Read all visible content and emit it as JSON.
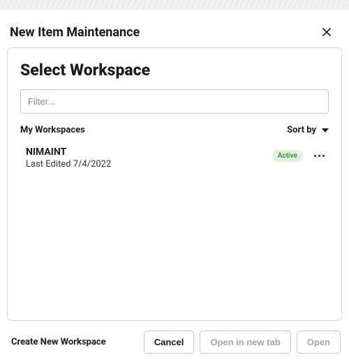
{
  "modal": {
    "title": "New Item Maintenance"
  },
  "card": {
    "title": "Select Workspace",
    "filter_placeholder": "Filter..."
  },
  "list_header": {
    "my_label": "My Workspaces",
    "sort_label": "Sort by"
  },
  "workspaces": [
    {
      "name": "NIMAINT",
      "last_edited": "Last Edited 7/4/2022",
      "status": "Active"
    }
  ],
  "footer": {
    "create_label": "Create New Workspace",
    "cancel": "Cancel",
    "open_new_tab": "Open in new tab",
    "open": "Open"
  }
}
